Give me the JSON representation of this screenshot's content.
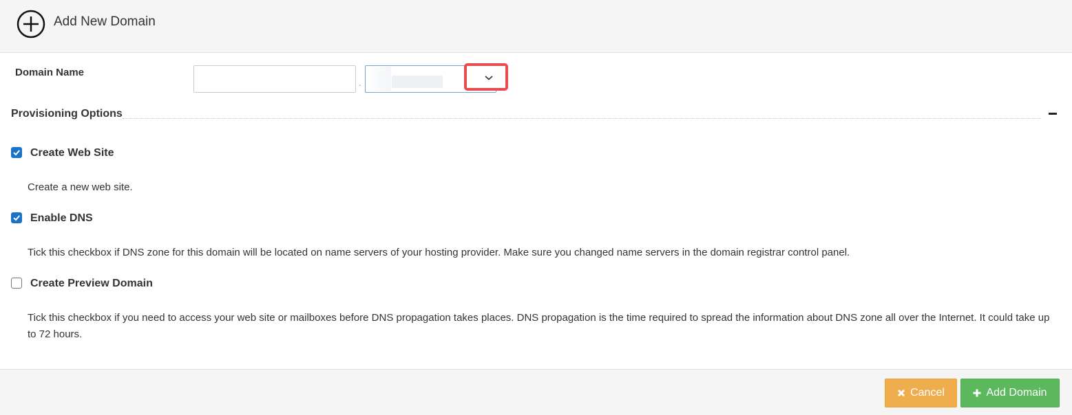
{
  "header": {
    "title": "Add New Domain",
    "icon": "plus-circle-icon"
  },
  "form": {
    "domain_name_label": "Domain Name",
    "domain_input_value": "",
    "separator": ".",
    "zone_select_value": ""
  },
  "provisioning": {
    "title": "Provisioning Options",
    "collapse_symbol": "minus-icon",
    "options": [
      {
        "label": "Create Web Site",
        "checked": true,
        "description": "Create a new web site."
      },
      {
        "label": "Enable DNS",
        "checked": true,
        "description": "Tick this checkbox if DNS zone for this domain will be located on name servers of your hosting provider. Make sure you changed name servers in the domain registrar control panel."
      },
      {
        "label": "Create Preview Domain",
        "checked": false,
        "description": "Tick this checkbox if you need to access your web site or mailboxes before DNS propagation takes places. DNS propagation is the time required to spread the information about DNS zone all over the Internet. It could take up to 72 hours."
      }
    ]
  },
  "footer": {
    "cancel_label": "Cancel",
    "add_label": "Add Domain"
  },
  "colors": {
    "cancel": "#f0ad4e",
    "add": "#5cb85c",
    "checkbox": "#1a73c7",
    "highlight": "#e84c4f"
  }
}
